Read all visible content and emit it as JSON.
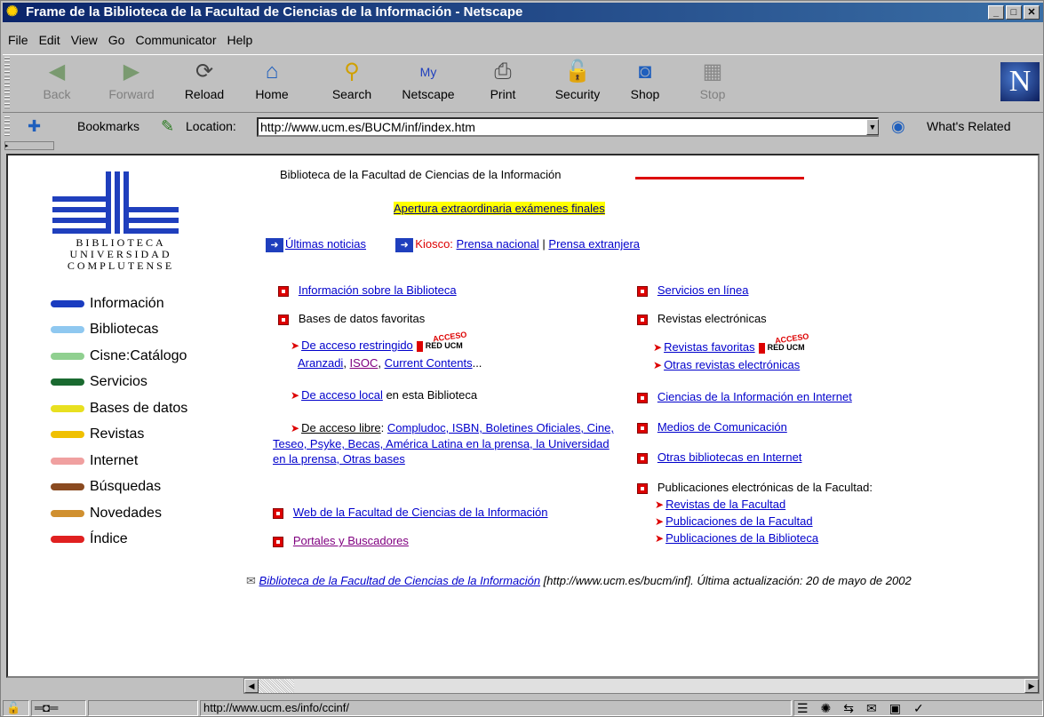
{
  "window": {
    "title": "Frame de la Biblioteca de la Facultad de Ciencias de la Información - Netscape",
    "buttons": [
      "_",
      "□",
      "✕"
    ]
  },
  "menu": [
    "File",
    "Edit",
    "View",
    "Go",
    "Communicator",
    "Help"
  ],
  "toolbar": {
    "buttons": [
      {
        "label": "Back",
        "icon": "back-arrow-icon",
        "disabled": true
      },
      {
        "label": "Forward",
        "icon": "forward-arrow-icon",
        "disabled": true
      },
      {
        "label": "Reload",
        "icon": "reload-icon",
        "disabled": false
      },
      {
        "label": "Home",
        "icon": "home-icon",
        "disabled": false
      },
      {
        "label": "Search",
        "icon": "search-icon",
        "disabled": false
      },
      {
        "label": "Netscape",
        "icon": "netscape-icon",
        "disabled": false
      },
      {
        "label": "Print",
        "icon": "printer-icon",
        "disabled": false
      },
      {
        "label": "Security",
        "icon": "lock-icon",
        "disabled": false
      },
      {
        "label": "Shop",
        "icon": "shop-icon",
        "disabled": false
      },
      {
        "label": "Stop",
        "icon": "stop-icon",
        "disabled": true
      }
    ]
  },
  "locationbar": {
    "bookmarks_label": "Bookmarks",
    "location_label": "Location:",
    "url": "http://www.ucm.es/BUCM/inf/index.htm",
    "whats_related": "What's Related"
  },
  "logo": {
    "line1": "BIBLIOTECA",
    "line2": "UNIVERSIDAD",
    "line3": "COMPLUTENSE"
  },
  "sidenav": [
    {
      "label": "Información",
      "color": "#1a3cc0"
    },
    {
      "label": "Bibliotecas",
      "color": "#8fc8f0"
    },
    {
      "label": "Cisne:Catálogo",
      "color": "#90d090"
    },
    {
      "label": "Servicios",
      "color": "#1a6a30"
    },
    {
      "label": "Bases de datos",
      "color": "#e8e020"
    },
    {
      "label": "Revistas",
      "color": "#f0c000"
    },
    {
      "label": "Internet",
      "color": "#f0a0a0"
    },
    {
      "label": "Búsquedas",
      "color": "#8a4a20"
    },
    {
      "label": "Novedades",
      "color": "#d09030"
    },
    {
      "label": "Índice",
      "color": "#e02020"
    }
  ],
  "main": {
    "title": "Biblioteca de la Facultad de Ciencias de la Información",
    "highlight": "Apertura extraordinaria exámenes finales",
    "news": "Últimas noticias",
    "kiosco_label": "Kiosco:",
    "prensa_nacional": "Prensa nacional",
    "separator": "|",
    "prensa_extranjera": "Prensa extranjera",
    "left": {
      "info": "Información sobre la Biblioteca",
      "bases_title": "Bases de datos favoritas",
      "restringido": "De acceso restringido",
      "aranzadi": "Aranzadi",
      "isoc": "ISOC",
      "current": "Current Contents",
      "ellipsis": "...",
      "local": "De acceso local",
      "local_suffix": " en esta Biblioteca",
      "libre": "De acceso libre",
      "libre_colon": ":",
      "libre_links": "Compludoc, ISBN, Boletines Oficiales, Cine, Teseo, Psyke, Becas, América Latina en la prensa, la Universidad en la prensa,  Otras bases",
      "web": "Web de la Facultad de Ciencias de la Información",
      "portales": "Portales y Buscadores"
    },
    "right": {
      "servicios": "Servicios en línea",
      "revistas_title": "Revistas electrónicas",
      "revistas_fav": "Revistas favoritas",
      "otras_rev": "Otras revistas electrónicas",
      "ciencias": "Ciencias de la Información en Internet",
      "medios": "Medios de Comunicación",
      "otras_bib": "Otras bibliotecas en Internet",
      "pub_title": "Publicaciones electrónicas de la Facultad:",
      "pub1": "Revistas de la Facultad",
      "pub2": "Publicaciones de la Facultad",
      "pub3": "Publicaciones de la Biblioteca"
    },
    "acceso": "ACCESO",
    "red_ucm": "RED UCM",
    "footer_link": "Biblioteca de la Facultad de Ciencias de la Información",
    "footer_text": " [http://www.ucm.es/bucm/inf]. Última actualización: 20 de mayo de 2002"
  },
  "status": {
    "url": "http://www.ucm.es/info/ccinf/"
  }
}
